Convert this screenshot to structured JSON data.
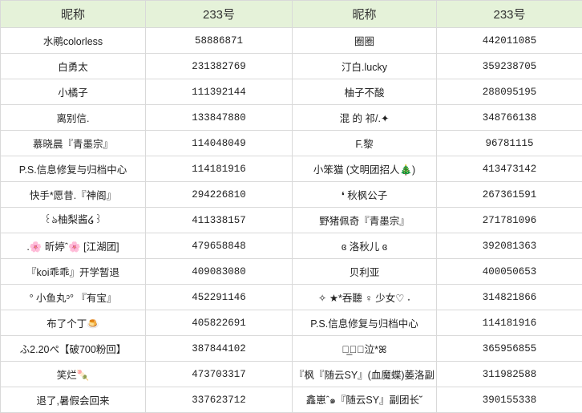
{
  "header": {
    "col_nickname_1": "昵称",
    "col_id_1": "233号",
    "col_nickname_2": "昵称",
    "col_id_2": "233号"
  },
  "rows": [
    {
      "name1": "水鹇colorless",
      "id1": "58886871",
      "name2": "圈圈",
      "id2": "442011085"
    },
    {
      "name1": "白勇太",
      "id1": "231382769",
      "name2": "汀白.lucky",
      "id2": "359238705"
    },
    {
      "name1": "小橘子",
      "id1": "111392144",
      "name2": "柚子不酸",
      "id2": "288095195"
    },
    {
      "name1": "离别信.",
      "id1": "133847880",
      "name2": "混 的 祁/.✦",
      "id2": "348766138"
    },
    {
      "name1": "慕晓晨『青墨宗』",
      "id1": "114048049",
      "name2": "F.黎",
      "id2": "96781115"
    },
    {
      "name1": "P.S.信息修复与归档中心",
      "id1": "114181916",
      "name2": "小笨猫 (文明团招人🎄)",
      "id2": "413473142"
    },
    {
      "name1": "快手*愿昔.『神阁』",
      "id1": "294226810",
      "name2": "❛ 秋枫公子",
      "id2": "267361591"
    },
    {
      "name1": "꒰ঌ柚梨酱໒꒱",
      "id1": "411338157",
      "name2": "野猪佩奇『青墨宗』",
      "id2": "271781096"
    },
    {
      "name1": ".🌸 昕婷ˆ🌸 [江湖团]",
      "id1": "479658848",
      "name2": "ɞ 洛秋儿 ɞ",
      "id2": "392081363"
    },
    {
      "name1": "『koi乖乖』开学暂退",
      "id1": "409083080",
      "name2": "贝利亚",
      "id2": "400050653"
    },
    {
      "name1": "° 小鱼丸ᵓ° 『有宝』",
      "id1": "452291146",
      "name2": "✧ ★*吞聽 ♀ 少女♡ ˖",
      "id2": "314821866"
    },
    {
      "name1": "布了个丁🍮",
      "id1": "405822691",
      "name2": "P.S.信息修复与归档中心",
      "id2": "114181916"
    },
    {
      "name1": "ふ2.20ぺ【破700粉回】",
      "id1": "387844102",
      "name2": "ค̲ี่泣*ꕤ",
      "id2": "365956855"
    },
    {
      "name1": "笑烂🍡",
      "id1": "473703317",
      "name2": "『枫『随云SY』(血魔蝶)萎洛副",
      "id2": "311982588"
    },
    {
      "name1": "退了,暑假会回来",
      "id1": "337623712",
      "name2": "鑫崽ˆ๑『随云SY』副团长˘",
      "id2": "390155338"
    }
  ]
}
